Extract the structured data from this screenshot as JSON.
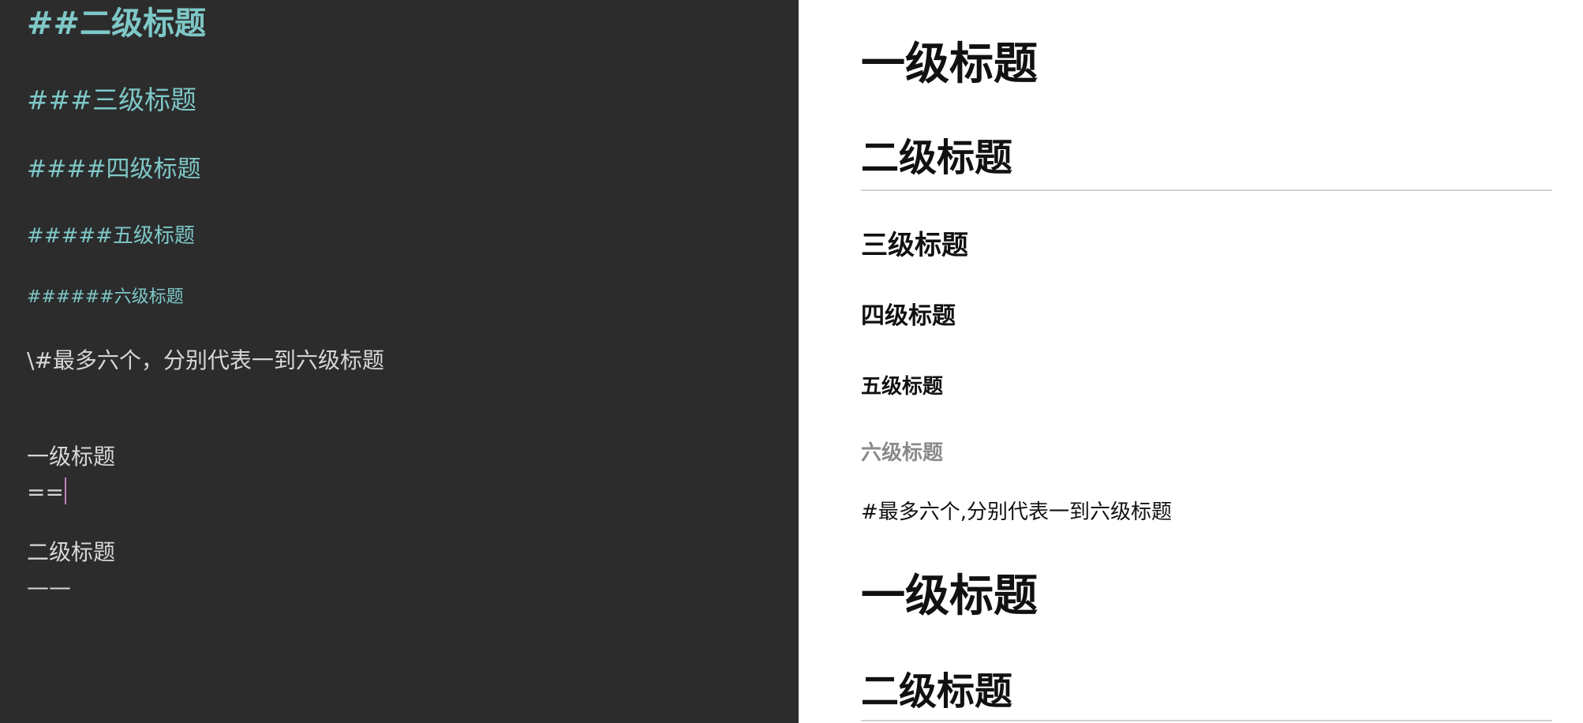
{
  "editor": {
    "lines": {
      "h2": "##二级标题",
      "h3": "###三级标题",
      "h4": "####四级标题",
      "h5": "#####五级标题",
      "h6": "######六级标题",
      "escaped": "\\#最多六个，分别代表一到六级标题",
      "setext_h1_text": "一级标题",
      "setext_h1_marker": "==",
      "setext_h2_text": "二级标题",
      "setext_h2_marker": "——"
    },
    "colors": {
      "background": "#2c2c2d",
      "heading_syntax": "#7ec8c7",
      "text": "#d7d7d7",
      "caret": "#c47fbf"
    }
  },
  "preview": {
    "h1": "一级标题",
    "h2": "二级标题",
    "h3": "三级标题",
    "h4": "四级标题",
    "h5": "五级标题",
    "h6": "六级标题",
    "paragraph": "#最多六个,分别代表一到六级标题",
    "setext_h1": "一级标题",
    "setext_h2": "二级标题",
    "colors": {
      "background": "#ffffff",
      "text": "#111111",
      "h6_text": "#8a8a8a",
      "rule": "#d2d2d2"
    }
  }
}
